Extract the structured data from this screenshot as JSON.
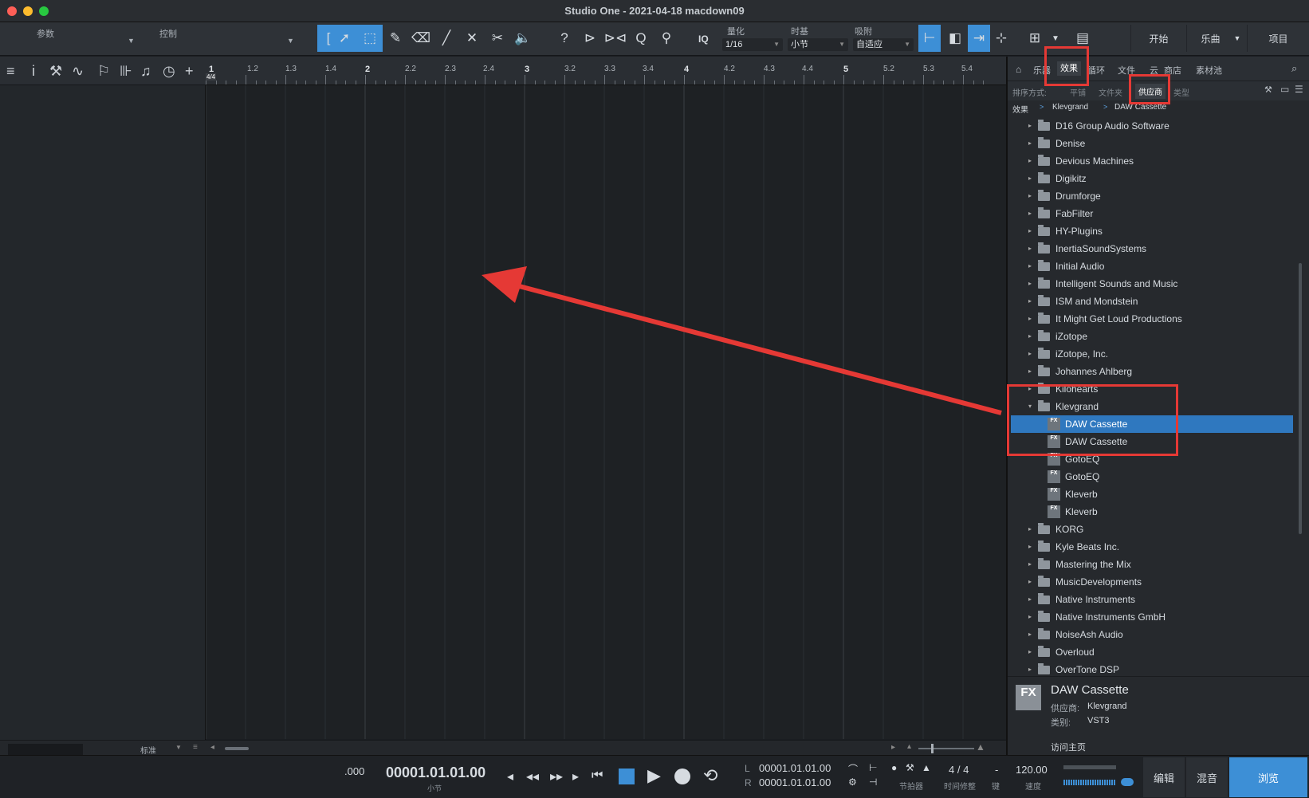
{
  "window": {
    "title": "Studio One - 2021-04-18 macdown09"
  },
  "toolbar": {
    "params_label": "参数",
    "control_label": "控制",
    "quantize_label": "量化",
    "quantize_value": "1/16",
    "timebase_label": "时基",
    "timebase_value": "小节",
    "snap_label": "吸附",
    "snap_value": "自适应",
    "iq_label": "IQ",
    "start_label": "开始",
    "song_label": "乐曲",
    "project_label": "项目"
  },
  "ruler": {
    "labels": [
      "1",
      "1.2",
      "1.3",
      "1.4",
      "2",
      "2.2",
      "2.3",
      "2.4",
      "3",
      "3.2",
      "3.3",
      "3.4",
      "4",
      "4.2",
      "4.3",
      "4.4",
      "5",
      "5.2",
      "5.3",
      "5.4"
    ],
    "time_sig": "4/4"
  },
  "browser": {
    "tabs": [
      "乐器",
      "效果",
      "循环",
      "文件",
      "云",
      "商店",
      "素材池"
    ],
    "active_tab": "效果",
    "sort_label": "排序方式:",
    "sort_options": [
      "平铺",
      "文件夹",
      "供应商",
      "类型"
    ],
    "active_sort": "供应商",
    "breadcrumb": [
      "效果",
      "Klevgrand",
      "DAW Cassette"
    ],
    "tree": [
      {
        "type": "folder",
        "label": "D16 Group Audio Software"
      },
      {
        "type": "folder",
        "label": "Denise"
      },
      {
        "type": "folder",
        "label": "Devious Machines"
      },
      {
        "type": "folder",
        "label": "Digikitz"
      },
      {
        "type": "folder",
        "label": "Drumforge"
      },
      {
        "type": "folder",
        "label": "FabFilter"
      },
      {
        "type": "folder",
        "label": "HY-Plugins"
      },
      {
        "type": "folder",
        "label": "InertiaSoundSystems"
      },
      {
        "type": "folder",
        "label": "Initial Audio"
      },
      {
        "type": "folder",
        "label": "Intelligent Sounds and Music"
      },
      {
        "type": "folder",
        "label": "ISM and Mondstein"
      },
      {
        "type": "folder",
        "label": "It Might Get Loud Productions"
      },
      {
        "type": "folder",
        "label": "iZotope"
      },
      {
        "type": "folder",
        "label": "iZotope, Inc."
      },
      {
        "type": "folder",
        "label": "Johannes Ahlberg"
      },
      {
        "type": "folder",
        "label": "Kilohearts"
      },
      {
        "type": "folder-open",
        "label": "Klevgrand"
      },
      {
        "type": "fx",
        "label": "DAW Cassette",
        "selected": true
      },
      {
        "type": "fx",
        "label": "DAW Cassette"
      },
      {
        "type": "fx",
        "label": "GotoEQ"
      },
      {
        "type": "fx",
        "label": "GotoEQ"
      },
      {
        "type": "fx",
        "label": "Kleverb"
      },
      {
        "type": "fx",
        "label": "Kleverb"
      },
      {
        "type": "folder",
        "label": "KORG"
      },
      {
        "type": "folder",
        "label": "Kyle Beats Inc."
      },
      {
        "type": "folder",
        "label": "Mastering the Mix"
      },
      {
        "type": "folder",
        "label": "MusicDevelopments"
      },
      {
        "type": "folder",
        "label": "Native Instruments"
      },
      {
        "type": "folder",
        "label": "Native Instruments GmbH"
      },
      {
        "type": "folder",
        "label": "NoiseAsh Audio"
      },
      {
        "type": "folder",
        "label": "Overloud"
      },
      {
        "type": "folder",
        "label": "OverTone DSP"
      }
    ],
    "info": {
      "name": "DAW Cassette",
      "vendor_label": "供应商:",
      "vendor": "Klevgrand",
      "category_label": "类别:",
      "category": "VST3",
      "homepage": "访问主页"
    }
  },
  "left_footer": {
    "mode": "标准"
  },
  "transport": {
    "left_num": ".000",
    "position": "00001.01.01.00",
    "position_unit": "小节",
    "loop_l": "00001.01.01.00",
    "loop_r": "00001.01.01.00",
    "l_label": "L",
    "r_label": "R",
    "metronome_label": "节拍器",
    "timesig_value": "4 / 4",
    "timesig_label": "时间修整",
    "key_value": "-",
    "key_label": "键",
    "tempo_value": "120.00",
    "tempo_label": "速度",
    "edit_label": "编辑",
    "mix_label": "混音",
    "browse_label": "浏览"
  },
  "colors": {
    "accent": "#3d8fd6",
    "annotation": "#e53935"
  }
}
